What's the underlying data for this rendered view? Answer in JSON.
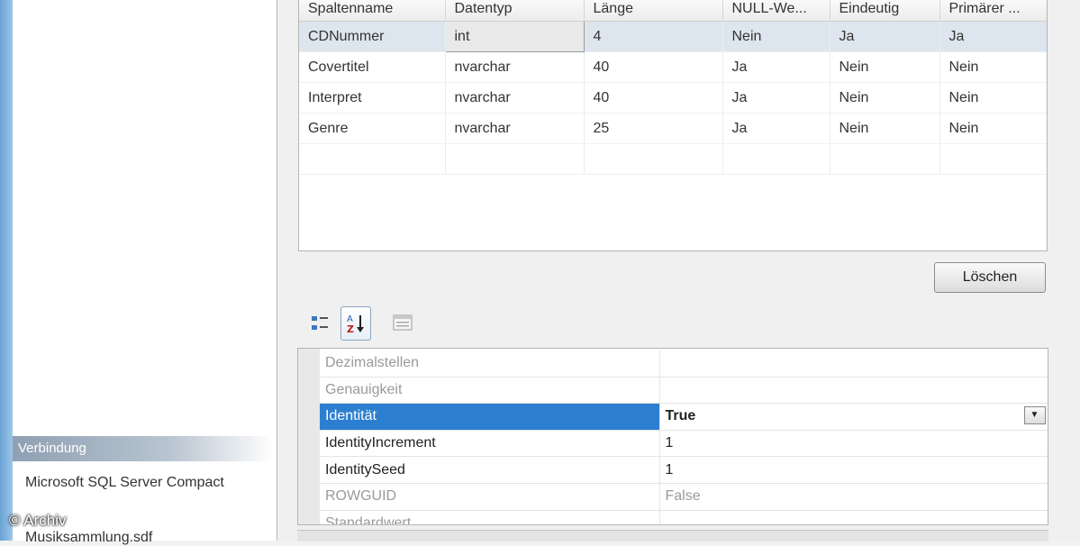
{
  "left_panel": {
    "section_header": "Verbindung",
    "connection": "Microsoft SQL Server Compact",
    "file": "Musiksammlung.sdf",
    "copyright": "© Archiv"
  },
  "grid": {
    "columns": [
      "Spaltenname",
      "Datentyp",
      "Länge",
      "NULL-We...",
      "Eindeutig",
      "Primärer ..."
    ],
    "rows": [
      [
        "CDNummer",
        "int",
        "4",
        "Nein",
        "Ja",
        "Ja"
      ],
      [
        "Covertitel",
        "nvarchar",
        "40",
        "Ja",
        "Nein",
        "Nein"
      ],
      [
        "Interpret",
        "nvarchar",
        "40",
        "Ja",
        "Nein",
        "Nein"
      ],
      [
        "Genre",
        "nvarchar",
        "25",
        "Ja",
        "Nein",
        "Nein"
      ]
    ]
  },
  "buttons": {
    "delete": "Löschen"
  },
  "toolbar": {
    "categorized_icon": "categorized-icon",
    "alphabetical_icon": "sort-alphabetical-icon",
    "property_pages_icon": "property-pages-icon"
  },
  "properties": {
    "rows": [
      {
        "name": "Dezimalstellen",
        "value": ""
      },
      {
        "name": "Genauigkeit",
        "value": ""
      },
      {
        "name": "Identität",
        "value": "True"
      },
      {
        "name": "IdentityIncrement",
        "value": "1"
      },
      {
        "name": "IdentitySeed",
        "value": "1"
      },
      {
        "name": "ROWGUID",
        "value": "False"
      },
      {
        "name": "Standardwert",
        "value": ""
      }
    ]
  },
  "colors": {
    "selection": "#2c7fd0",
    "header_gradient": "#8fa0b3"
  }
}
